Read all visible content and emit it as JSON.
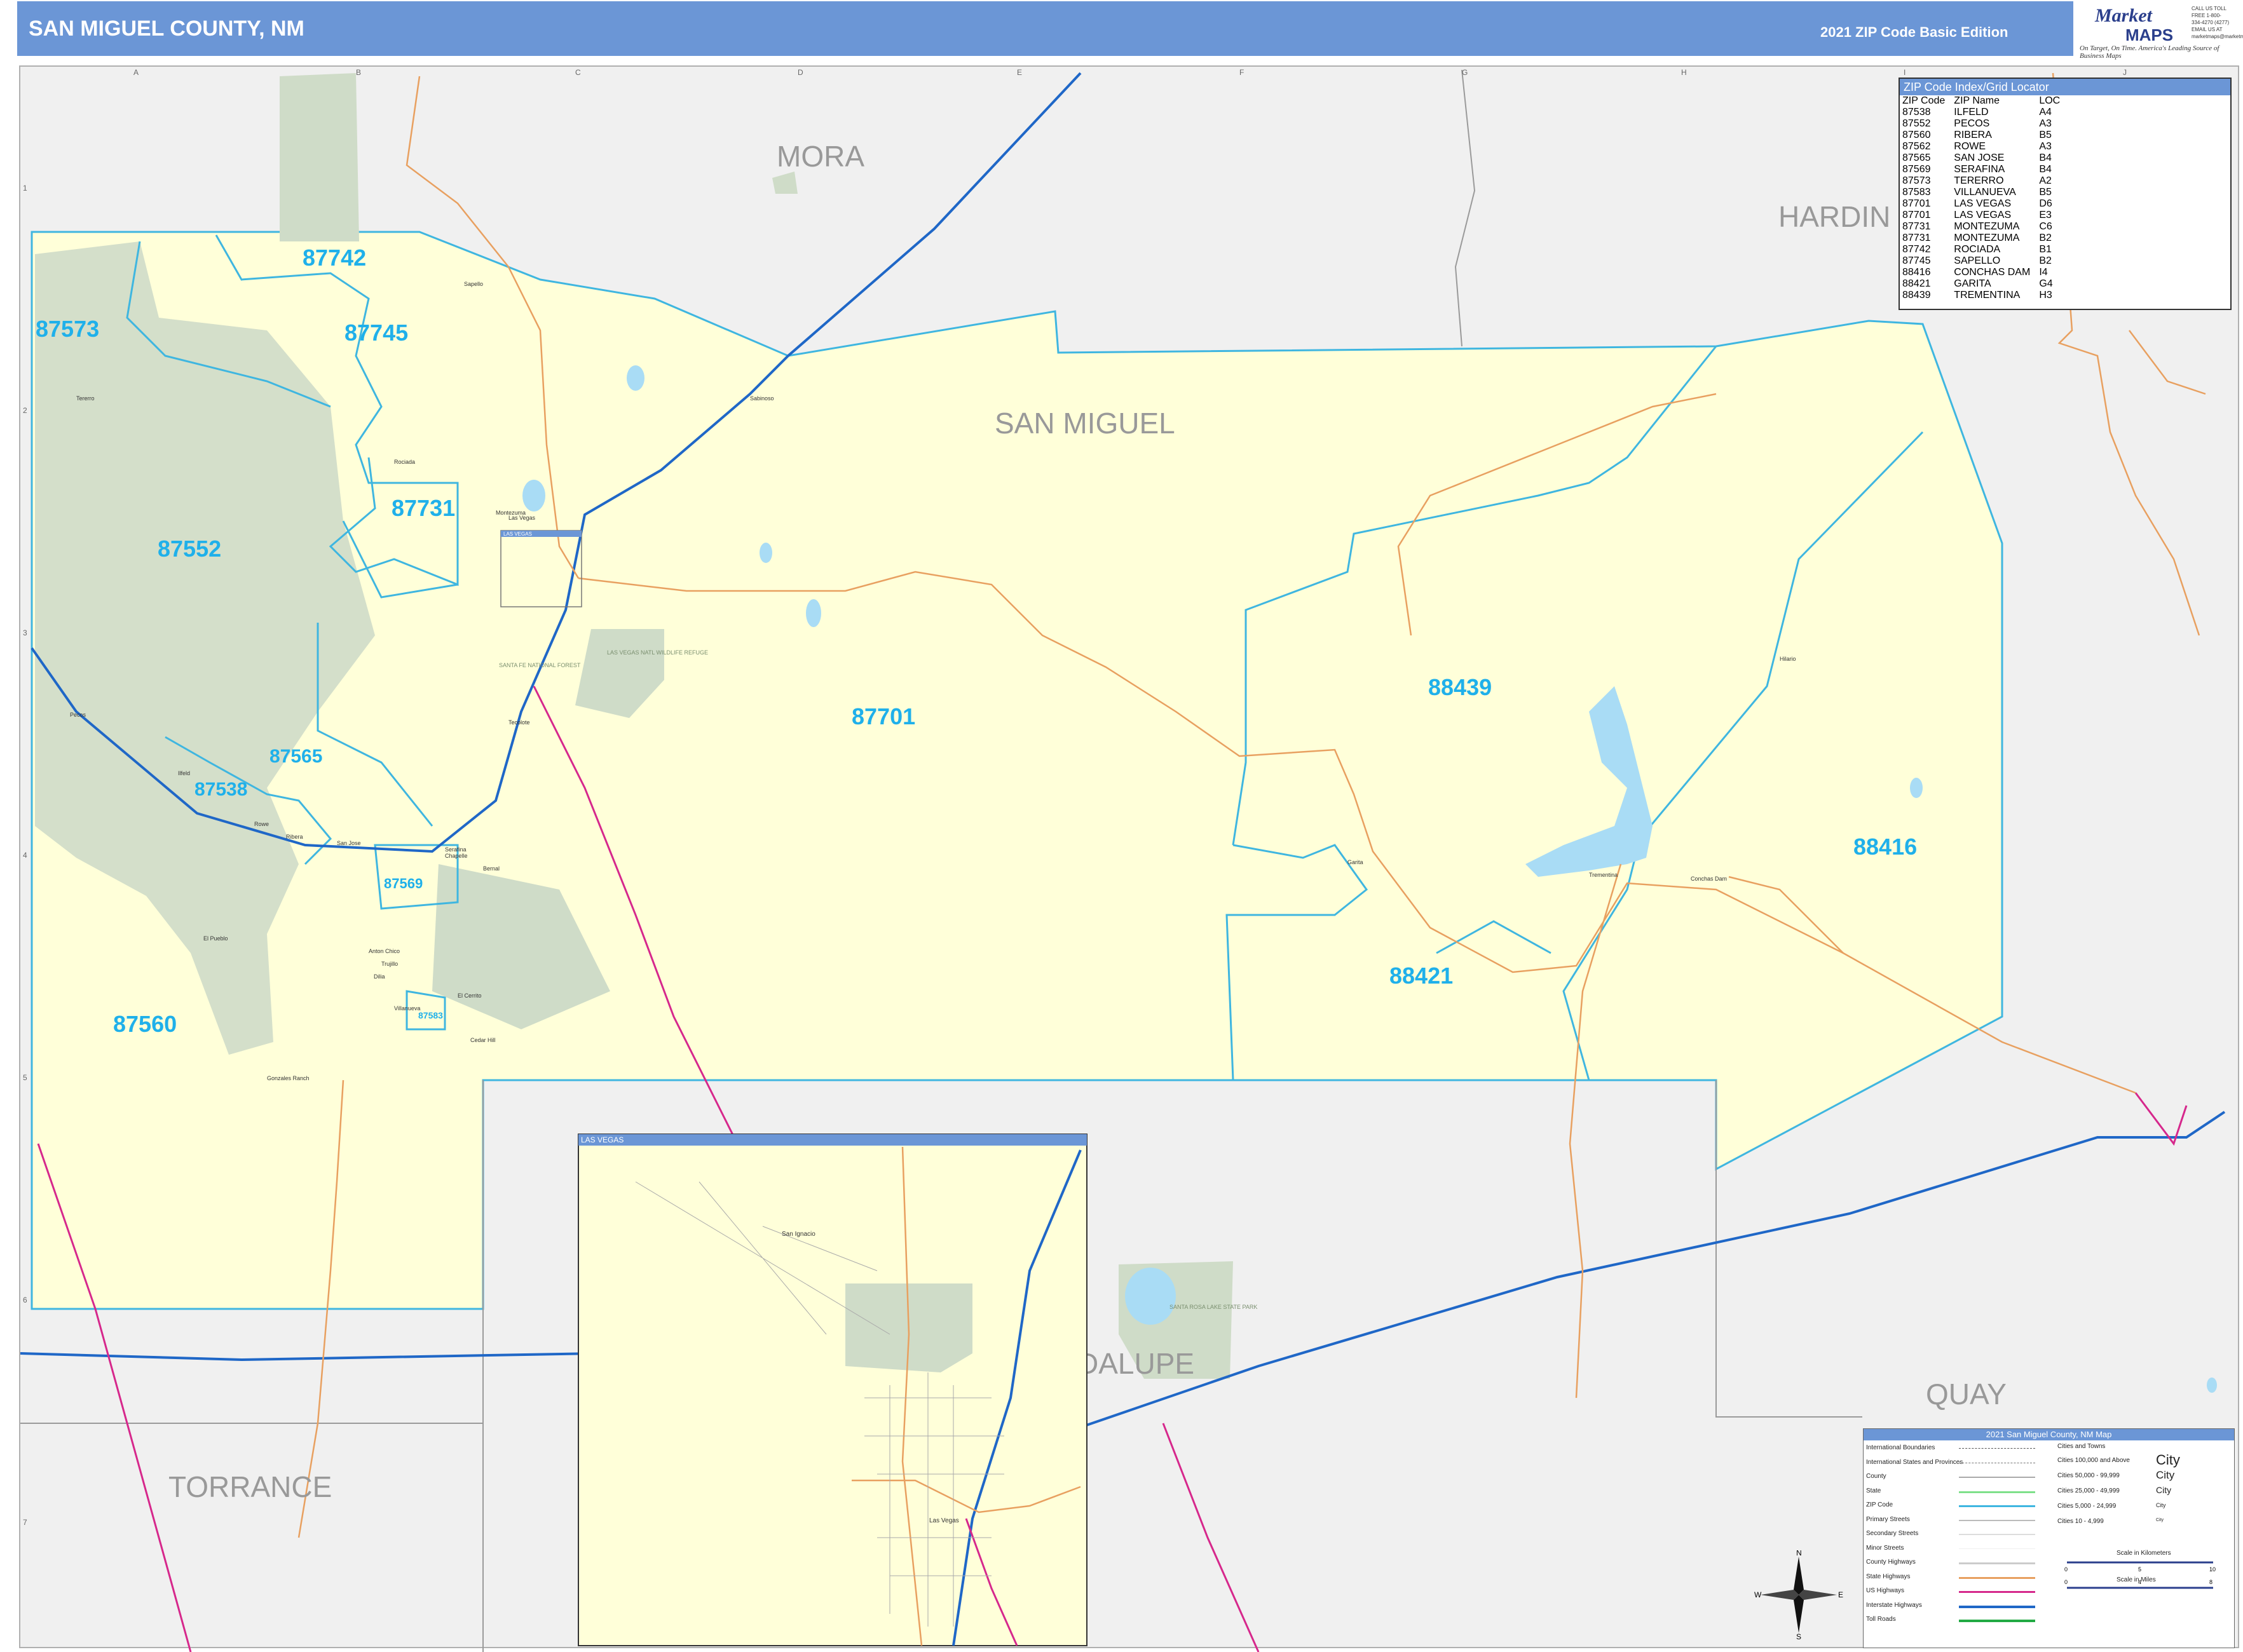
{
  "header": {
    "title": "SAN MIGUEL COUNTY, NM",
    "edition": "2021 ZIP Code Basic Edition",
    "logo_market": "Market",
    "logo_maps": "MAPS",
    "logo_tagline": "On Target, On Time. America's Leading Source of Business Maps",
    "logo_contact": "CALL US TOLL FREE 1-800-334-4270 (4277) EMAIL US AT marketmaps@marketmaps.com"
  },
  "colors": {
    "header_bar": "#6b96d6",
    "county_fill": "#ffffd9",
    "outside_fill": "#f0f0f0",
    "forest_fill": "#cfdcc8",
    "zip_boundary": "#3fb6e0",
    "zip_label": "#1fb0ea",
    "water": "#a9dcf5",
    "interstate": "#1f67c7",
    "us_highway": "#d6288c",
    "state_highway": "#e8a060"
  },
  "grid": {
    "columns": [
      "A",
      "B",
      "C",
      "D",
      "E",
      "F",
      "G",
      "H",
      "I",
      "J"
    ],
    "rows": [
      "1",
      "2",
      "3",
      "4",
      "5",
      "6",
      "7"
    ]
  },
  "map": {
    "county_labels": [
      "MORA",
      "HARDIN",
      "SAN MIGUEL",
      "TORRANCE",
      "DALUPE",
      "QUAY"
    ],
    "zip_labels": [
      "87742",
      "87573",
      "87745",
      "87731",
      "87552",
      "87701",
      "88439",
      "87565",
      "87538",
      "88416",
      "87569",
      "88421",
      "87560",
      "87583"
    ],
    "features": {
      "las_vegas_box_label": "LAS VEGAS",
      "forest_label": "SANTA FE NATIONAL FOREST",
      "refuge_label": "LAS VEGAS NATL WILDLIFE REFUGE",
      "lake_label": "SANTA ROSA LAKE STATE PARK"
    },
    "places": [
      "Las Vegas",
      "Pecos",
      "Rowe",
      "Ribera",
      "San Jose",
      "Villanueva",
      "Conchas Dam",
      "Trementina",
      "Sapello",
      "Rociada",
      "Montezuma",
      "Tererro",
      "Ilfeld",
      "Serafina",
      "Garita",
      "El Cerrito",
      "Dilia",
      "Anton Chico",
      "Gonzales Ranch",
      "El Pueblo",
      "Chapelle",
      "Bernal",
      "Tecolote",
      "Cedar Hill",
      "Trujillo",
      "Sabinoso",
      "Hilario"
    ]
  },
  "inset": {
    "title": "LAS VEGAS",
    "places": [
      "San Ignacio",
      "Las Vegas"
    ]
  },
  "zip_index": {
    "title": "ZIP Code Index/Grid Locator",
    "headers": [
      "ZIP Code",
      "ZIP Name",
      "LOC"
    ],
    "rows": [
      [
        "87538",
        "ILFELD",
        "A4"
      ],
      [
        "87552",
        "PECOS",
        "A3"
      ],
      [
        "87560",
        "RIBERA",
        "B5"
      ],
      [
        "87562",
        "ROWE",
        "A3"
      ],
      [
        "87565",
        "SAN JOSE",
        "B4"
      ],
      [
        "87569",
        "SERAFINA",
        "B4"
      ],
      [
        "87573",
        "TERERRO",
        "A2"
      ],
      [
        "87583",
        "VILLANUEVA",
        "B5"
      ],
      [
        "87701",
        "LAS VEGAS",
        "D6"
      ],
      [
        "87701",
        "LAS VEGAS",
        "E3"
      ],
      [
        "87731",
        "MONTEZUMA",
        "C6"
      ],
      [
        "87731",
        "MONTEZUMA",
        "B2"
      ],
      [
        "87742",
        "ROCIADA",
        "B1"
      ],
      [
        "87745",
        "SAPELLO",
        "B2"
      ],
      [
        "88416",
        "CONCHAS DAM",
        "I4"
      ],
      [
        "88421",
        "GARITA",
        "G4"
      ],
      [
        "88439",
        "TREMENTINA",
        "H3"
      ]
    ]
  },
  "legend": {
    "title": "2021 San Miguel County, NM Map",
    "boundaries": [
      "International Boundaries",
      "International States and Provinces",
      "County",
      "State",
      "ZIP Code",
      "Primary Streets",
      "Secondary Streets",
      "Minor Streets",
      "County Highways",
      "State Highways",
      "US Highways",
      "Interstate Highways",
      "Toll Roads"
    ],
    "cities_header": "Cities and Towns",
    "city_sizes": [
      {
        "label": "Cities 100,000 and Above",
        "sample": "City"
      },
      {
        "label": "Cities 50,000 - 99,999",
        "sample": "City"
      },
      {
        "label": "Cities 25,000 - 49,999",
        "sample": "City"
      },
      {
        "label": "Cities 5,000 - 24,999",
        "sample": "City"
      },
      {
        "label": "Cities 10 - 4,999",
        "sample": "City"
      }
    ],
    "scale_km": "Scale in Kilometers",
    "scale_mi": "Scale in Miles",
    "km_ticks": [
      "0",
      "5",
      "10"
    ],
    "mi_ticks": [
      "0",
      "4",
      "8"
    ]
  },
  "compass": {
    "n": "N",
    "s": "S",
    "e": "E",
    "w": "W"
  }
}
